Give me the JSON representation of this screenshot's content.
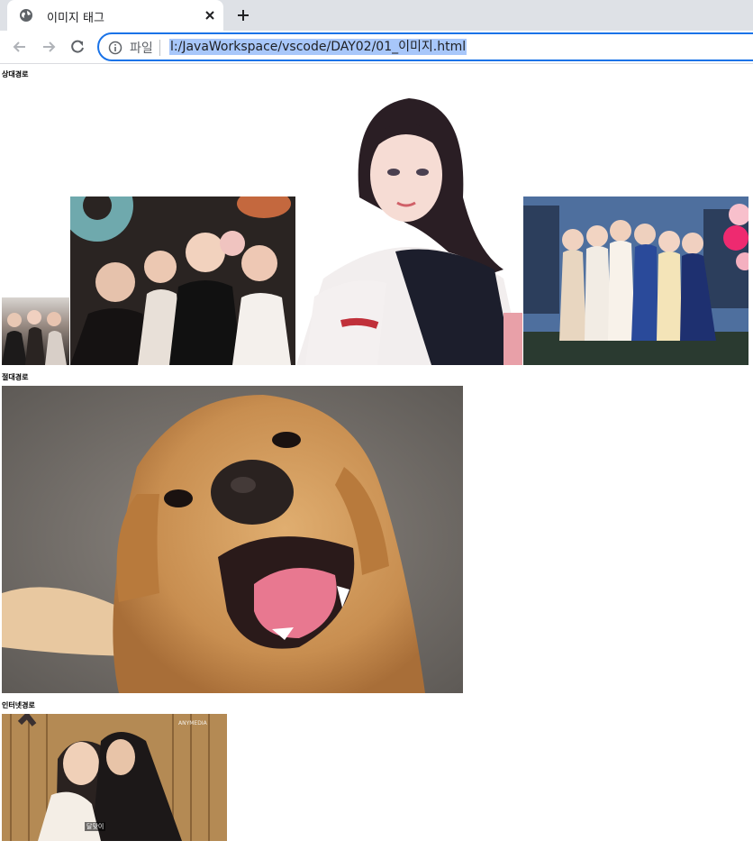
{
  "browser": {
    "tab_title": "이미지 태그",
    "scheme_label": "파일",
    "url": "l:/JavaWorkspace/vscode/DAY02/01_이미지.html"
  },
  "page": {
    "relative_heading": "상대경로",
    "absolute_heading": "절대경로",
    "internet_heading": "인터넷경로",
    "caption_text": "달맞이",
    "caption_watermark": "ANYMEDIA"
  },
  "icons": {
    "favicon": "globe-icon",
    "close": "close-icon",
    "new_tab": "plus-icon",
    "back": "arrow-left-icon",
    "forward": "arrow-right-icon",
    "reload": "reload-icon",
    "info": "info-icon"
  },
  "colors": {
    "tabbar_bg": "#dee1e6",
    "focus_ring": "#1a73e8",
    "url_selection": "#a8c7fa"
  }
}
